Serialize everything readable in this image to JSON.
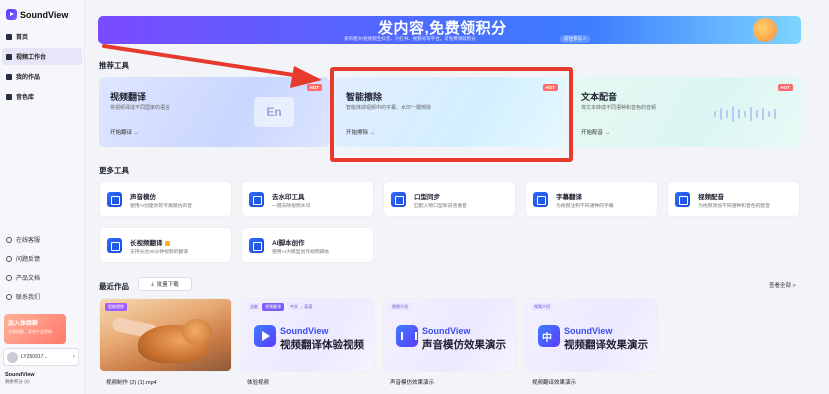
{
  "app": {
    "name": "SoundView"
  },
  "sidebar": {
    "items": [
      {
        "label": "首页",
        "active": false
      },
      {
        "label": "视频工作台",
        "active": true
      },
      {
        "label": "我的作品",
        "active": false
      },
      {
        "label": "音色库",
        "active": false
      }
    ],
    "bottom_items": [
      {
        "label": "在线客服"
      },
      {
        "label": "问题反馈"
      },
      {
        "label": "产品文档"
      },
      {
        "label": "联系我们"
      }
    ],
    "promo": {
      "title": "加入体验群",
      "subtitle": "立即加群，享有产品更新"
    },
    "user": {
      "name": "LY250917..."
    },
    "credits": {
      "title": "SoundView",
      "subtitle": "剩余积分 (0)"
    }
  },
  "banner": {
    "title": "发内容,免费领积分",
    "subtitle": "发布图文/短视频至抖音、小红书、视频号等平台，可免费领取积分",
    "button": "前往参与 >"
  },
  "recommended": {
    "title": "推荐工具",
    "cards": [
      {
        "name": "视频翻译",
        "desc": "将视频译成不同国家的语言",
        "action": "开始翻译 →",
        "badge": "HOT"
      },
      {
        "name": "智能擦除",
        "desc": "智能抹掉视频中的字幕、水印一键擦除",
        "action": "开始擦除 →",
        "badge": "HOT"
      },
      {
        "name": "文本配音",
        "desc": "将文本转成不同语种和音色的音频",
        "action": "开始配音 →",
        "badge": "HOT"
      }
    ]
  },
  "more_tools": {
    "title": "更多工具",
    "tiles": [
      {
        "name": "声音模仿",
        "desc": "使用AI创建你的专属模仿声音"
      },
      {
        "name": "去水印工具",
        "desc": "一键去除视频水印"
      },
      {
        "name": "口型同步",
        "desc": "匹配人物口型和说话语音"
      },
      {
        "name": "字幕翻译",
        "desc": "为视频注制不同语种的字幕"
      },
      {
        "name": "视频配音",
        "desc": "为视频添加不同语种和音色的配音"
      },
      {
        "name": "长视频翻译",
        "desc": "支持长达30分钟视频的翻译"
      },
      {
        "name": "AI脚本创作",
        "desc": "使用AI大模型创作视频脚本"
      }
    ]
  },
  "recent": {
    "title": "最近作品",
    "batch_download": "批量下载",
    "view_all": "查看全部 >",
    "works": [
      {
        "tag": "智能擦除",
        "caption": "视频制作 (2) (1).mp4",
        "type": "photo"
      },
      {
        "tags": [
          "全能",
          "视频翻译",
          "中文 → 英语"
        ],
        "brand": "SoundView",
        "title": "视频翻译体验视频",
        "caption": "体验视频",
        "icon": "play"
      },
      {
        "tags": [
          "视频介绍"
        ],
        "brand": "SoundView",
        "title": "声音模仿效果演示",
        "caption": "声音模仿效果演示",
        "icon": "wave"
      },
      {
        "tags": [
          "视频介绍"
        ],
        "brand": "SoundView",
        "title": "视频翻译效果演示",
        "caption": "视频翻译效果演示",
        "icon": "zh"
      }
    ]
  },
  "colors": {
    "accent": "#5b3cff",
    "highlight": "#e8392f",
    "hot": "#ff6a6a"
  }
}
